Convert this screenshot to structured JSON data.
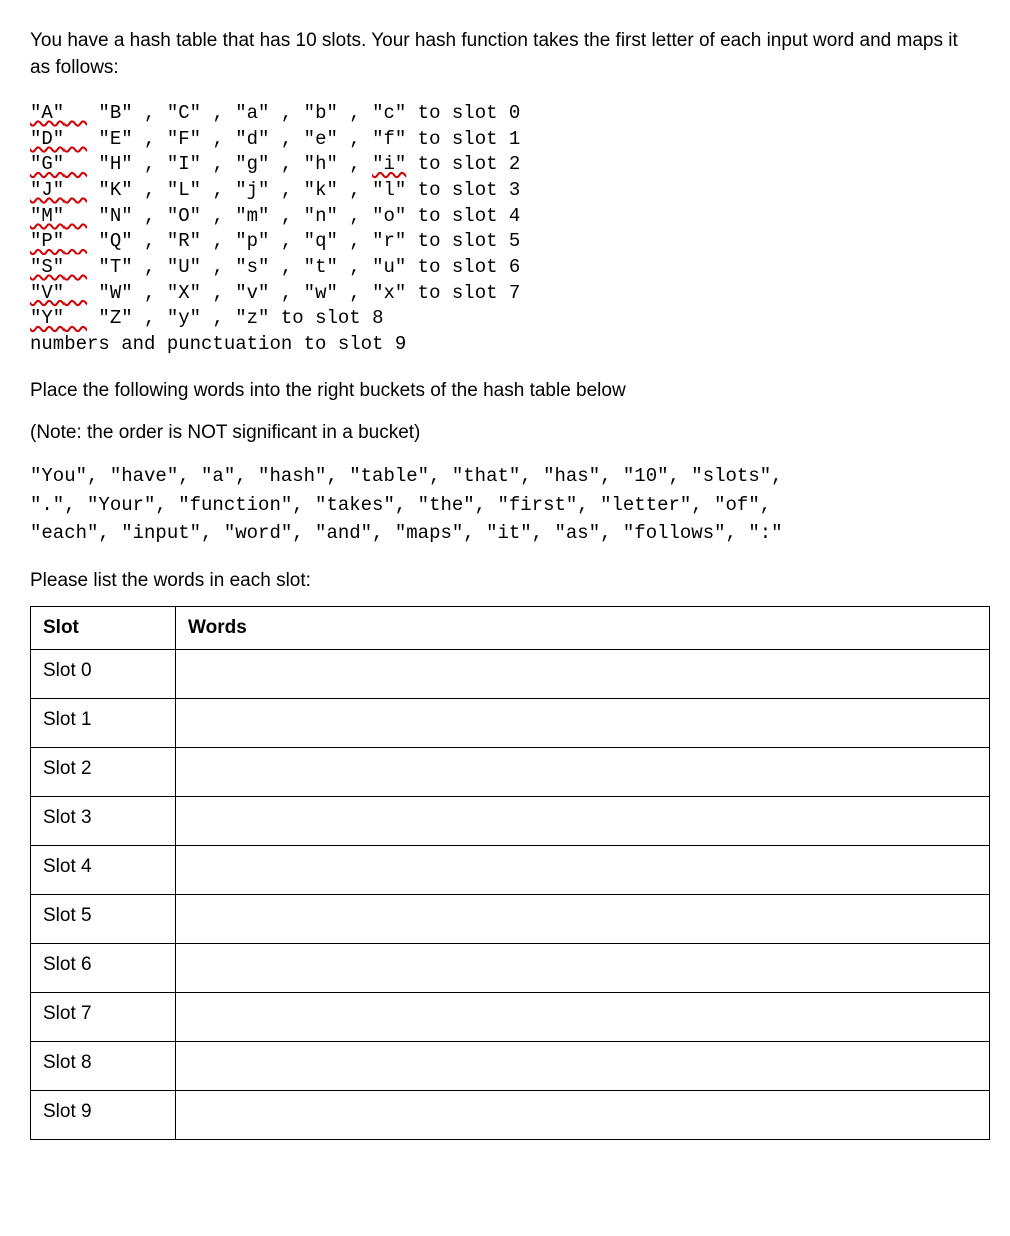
{
  "intro": "You have a hash table that has 10 slots. Your hash function takes the first letter of each input word and maps it as follows:",
  "mapping": [
    {
      "first": "\"A\"",
      "rest": " \"B\" , \"C\" , \"a\" , \"b\" , \"c\" to slot 0"
    },
    {
      "first": "\"D\"",
      "rest": " \"E\" , \"F\" , \"d\" , \"e\" , \"f\" to slot 1"
    },
    {
      "first": "\"G\"",
      "rest": " \"H\" , \"I\" , \"g\" , \"h\" , ",
      "spell": "\"i\"",
      "rest2": " to slot 2"
    },
    {
      "first": "\"J\"",
      "rest": " \"K\" , \"L\" , \"j\" , \"k\" , \"l\" to slot 3"
    },
    {
      "first": "\"M\"",
      "rest": " \"N\" , \"O\" , \"m\" , \"n\" , \"o\" to slot 4"
    },
    {
      "first": "\"P\"",
      "rest": " \"Q\" , \"R\" , \"p\" , \"q\" , \"r\" to slot 5"
    },
    {
      "first": "\"S\"",
      "rest": " \"T\" , \"U\" , \"s\" , \"t\" , \"u\" to slot 6"
    },
    {
      "first": "\"V\"",
      "rest": " \"W\" , \"X\" , \"v\" , \"w\" , \"x\" to slot 7"
    },
    {
      "first": "\"Y\"",
      "rest": " \"Z\" , \"y\" , \"z\" to slot 8"
    }
  ],
  "mapping_last": "numbers and punctuation to slot 9",
  "instruction": "Place the following words into the right buckets of the hash table below",
  "note": "(Note: the order is NOT significant in a bucket)",
  "wordlist_line1": "\"You\", \"have\", \"a\", \"hash\", \"table\", \"that\", \"has\", \"10\", \"slots\",",
  "wordlist_line2": "\".\", \"Your\", \"function\", \"takes\", \"the\", \"first\", \"letter\", \"of\",",
  "wordlist_line3": "\"each\", \"input\", \"word\", \"and\", \"maps\", \"it\", \"as\", \"follows\", \":\"",
  "list_header": "Please list the words in each slot:",
  "table": {
    "header_slot": "Slot",
    "header_words": "Words",
    "rows": [
      {
        "label": "Slot 0",
        "words": ""
      },
      {
        "label": "Slot 1",
        "words": ""
      },
      {
        "label": "Slot 2",
        "words": ""
      },
      {
        "label": "Slot 3",
        "words": ""
      },
      {
        "label": "Slot 4",
        "words": ""
      },
      {
        "label": "Slot 5",
        "words": ""
      },
      {
        "label": "Slot 6",
        "words": ""
      },
      {
        "label": "Slot 7",
        "words": ""
      },
      {
        "label": "Slot 8",
        "words": ""
      },
      {
        "label": "Slot 9",
        "words": ""
      }
    ]
  }
}
